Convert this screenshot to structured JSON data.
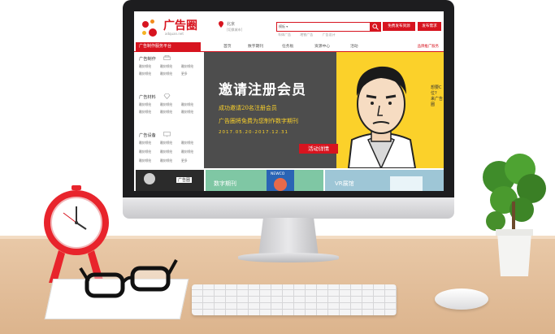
{
  "site": {
    "logo_text": "广告圈",
    "logo_sub": "adquan.net"
  },
  "header": {
    "location_name": "北京",
    "location_switch": "[切换城市]",
    "search_category": "模板 ▾",
    "hot_words": [
      "车体广告",
      "地铁广告",
      "广告设计"
    ],
    "btn_publish": "免费发布资源",
    "btn_demand": "发布需求"
  },
  "nav": {
    "category_label": "广告制作服务平台",
    "items": [
      "首页",
      "数字期刊",
      "任务板",
      "资源中心",
      "活动"
    ],
    "right_link": "品牌推广服务"
  },
  "sidebar": {
    "sections": [
      {
        "title": "广告制作",
        "icon": "printer-icon",
        "rows": [
          [
            "雕刻喷绘",
            "雕刻喷绘",
            "雕刻喷绘"
          ],
          [
            "雕刻喷绘",
            "雕刻喷绘",
            "更多"
          ]
        ]
      },
      {
        "title": "广告材料",
        "icon": "diamond-icon",
        "rows": [
          [
            "雕刻喷绘",
            "雕刻喷绘",
            "雕刻喷绘"
          ],
          [
            "雕刻喷绘",
            "雕刻喷绘",
            "雕刻喷绘"
          ]
        ]
      },
      {
        "title": "广告设备",
        "icon": "monitor-icon",
        "rows": [
          [
            "雕刻喷绘",
            "雕刻喷绘",
            "雕刻喷绘"
          ],
          [
            "雕刻喷绘",
            "雕刻喷绘",
            "雕刻喷绘"
          ],
          [
            "雕刻喷绘",
            "雕刻喷绘",
            "更多"
          ]
        ]
      }
    ]
  },
  "banner": {
    "title": "邀请注册会员",
    "line1": "成功邀请20名注册会员",
    "line2": "广告圈将免费为您制作数字期刊",
    "date_range": "2017.05.20-2017.12.31",
    "button": "活动详情",
    "side_text_1": "想要C位?",
    "side_text_2": "来广告圈"
  },
  "thumbs": [
    {
      "label": "广告圈",
      "color": "#2b2b2b"
    },
    {
      "label": "数字期刊",
      "color": "#7fc7a4"
    },
    {
      "label": "NEWCO",
      "color": "#2a64b5"
    },
    {
      "label": "VR展馆",
      "color": "#9ec6d6"
    }
  ],
  "colors": {
    "brand_red": "#d7141f",
    "banner_yellow": "#fbd12a",
    "banner_gray": "#4d4d4d"
  }
}
